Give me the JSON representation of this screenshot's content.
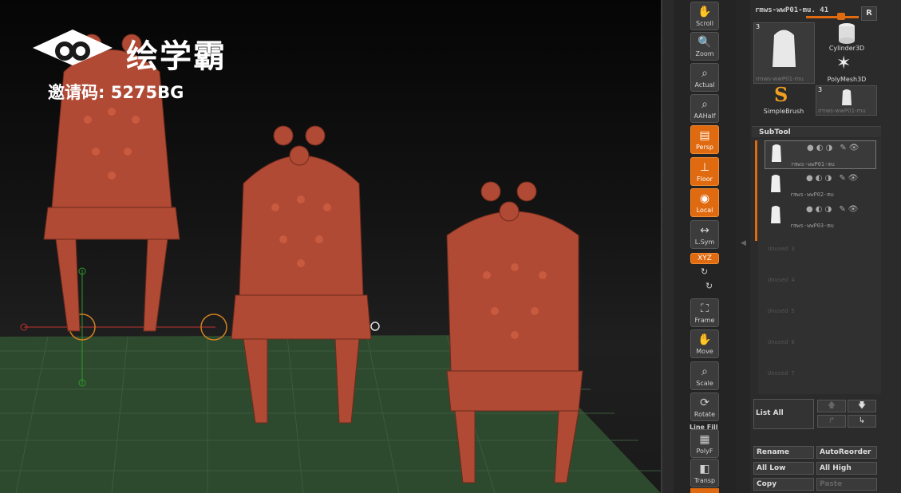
{
  "watermark": {
    "brand": "绘学霸",
    "invite_code": "邀请码: 5275BG"
  },
  "shelf": {
    "buttons": [
      {
        "label": "Scroll",
        "icon": "hand-icon",
        "active": false
      },
      {
        "label": "Zoom",
        "icon": "zoom-icon",
        "active": false
      },
      {
        "label": "Actual",
        "icon": "actual-icon",
        "active": false
      },
      {
        "label": "AAHalf",
        "icon": "aahalf-icon",
        "active": false
      },
      {
        "label": "Persp",
        "icon": "perspective-icon",
        "active": true
      },
      {
        "label": "Floor",
        "icon": "floor-icon",
        "active": true
      },
      {
        "label": "Local",
        "icon": "local-icon",
        "active": true
      },
      {
        "label": "L.Sym",
        "icon": "symmetry-icon",
        "active": false
      },
      {
        "label": "XYZ",
        "icon": "xyz-icon",
        "active": true
      },
      {
        "label": "Frame",
        "icon": "frame-icon",
        "active": false
      },
      {
        "label": "Move",
        "icon": "move-icon",
        "active": false
      },
      {
        "label": "Scale",
        "icon": "scale-icon",
        "active": false
      },
      {
        "label": "Rotate",
        "icon": "rotate-icon",
        "active": false
      },
      {
        "label": "PolyF",
        "icon": "polyframe-icon",
        "active": false
      },
      {
        "label": "Transp",
        "icon": "transparency-icon",
        "active": false
      }
    ],
    "line_fill_label": "Line Fill"
  },
  "tool": {
    "name": "rmws-wwP01-mu. 41",
    "r_label": "R",
    "thumbs": [
      {
        "label": "rmws-wwP01-mu",
        "count": "3"
      },
      {
        "label": "Cylinder3D"
      },
      {
        "label": "PolyMesh3D"
      },
      {
        "label": "SimpleBrush"
      },
      {
        "label": "rmws-wwP01-mu",
        "count": "3"
      }
    ]
  },
  "subtool": {
    "title": "SubTool",
    "items": [
      {
        "name": "rmws-wwP01-mu",
        "selected": true
      },
      {
        "name": "rmws-wwP02-mu",
        "selected": false
      },
      {
        "name": "rmws-wwP03-mu",
        "selected": false
      }
    ],
    "unused": [
      "Unused 3",
      "Unused 4",
      "Unused 5",
      "Unused 6",
      "Unused 7"
    ],
    "list_all": "List All",
    "buttons": {
      "rename": "Rename",
      "autoreorder": "AutoReorder",
      "all_low": "All Low",
      "all_high": "All High",
      "copy": "Copy",
      "paste": "Paste"
    }
  },
  "colors": {
    "accent": "#e06a10",
    "model": "#b04a34",
    "floor": "#2e4a2e"
  }
}
